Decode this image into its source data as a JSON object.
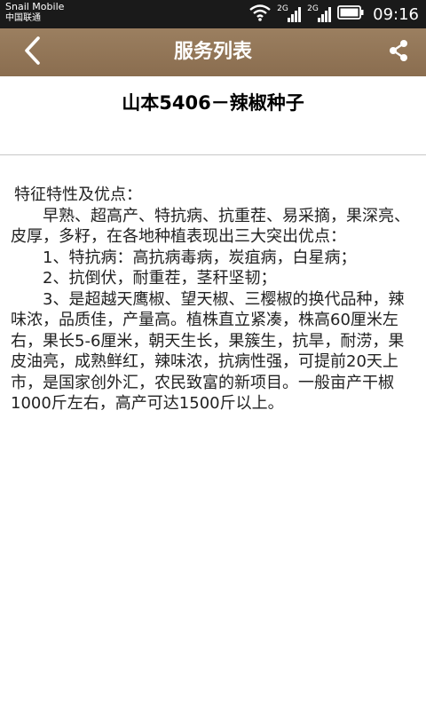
{
  "status_bar": {
    "carrier_name": "Snail Mobile",
    "carrier_network": "中国联通",
    "signal1_label": "2G",
    "signal2_label": "2G",
    "time": "09:16"
  },
  "header": {
    "title": "服务列表"
  },
  "article": {
    "title": "山本5406－辣椒种子",
    "body": [
      "特征特性及优点：",
      "　　早熟、超高产、特抗病、抗重茬、易采摘，果深亮、皮厚，多籽，在各地种植表现出三大突出优点：",
      "　　1、特抗病：高抗病毒病，炭疽病，白星病；",
      "　　2、抗倒伏，耐重茬，茎秆坚韧；",
      "　　3、是超越天鹰椒、望天椒、三樱椒的换代品种，辣味浓，品质佳，产量高。植株直立紧凑，株高60厘米左右，果长5-6厘米，朝天生长，果簇生，抗旱，耐涝，果皮油亮，成熟鲜红，辣味浓，抗病性强，可提前20天上市，是国家创外汇，农民致富的新项目。一般亩产干椒1000斤左右，高产可达1500斤以上。"
    ]
  },
  "icons": {
    "back": "chevron-left-icon",
    "share": "share-icon",
    "wifi": "wifi-icon",
    "signal": "signal-icon",
    "battery": "battery-icon"
  },
  "colors": {
    "title_bar": "#8a6d4f",
    "status_bar": "#1a1a1a",
    "divider": "#c8c8c8"
  }
}
